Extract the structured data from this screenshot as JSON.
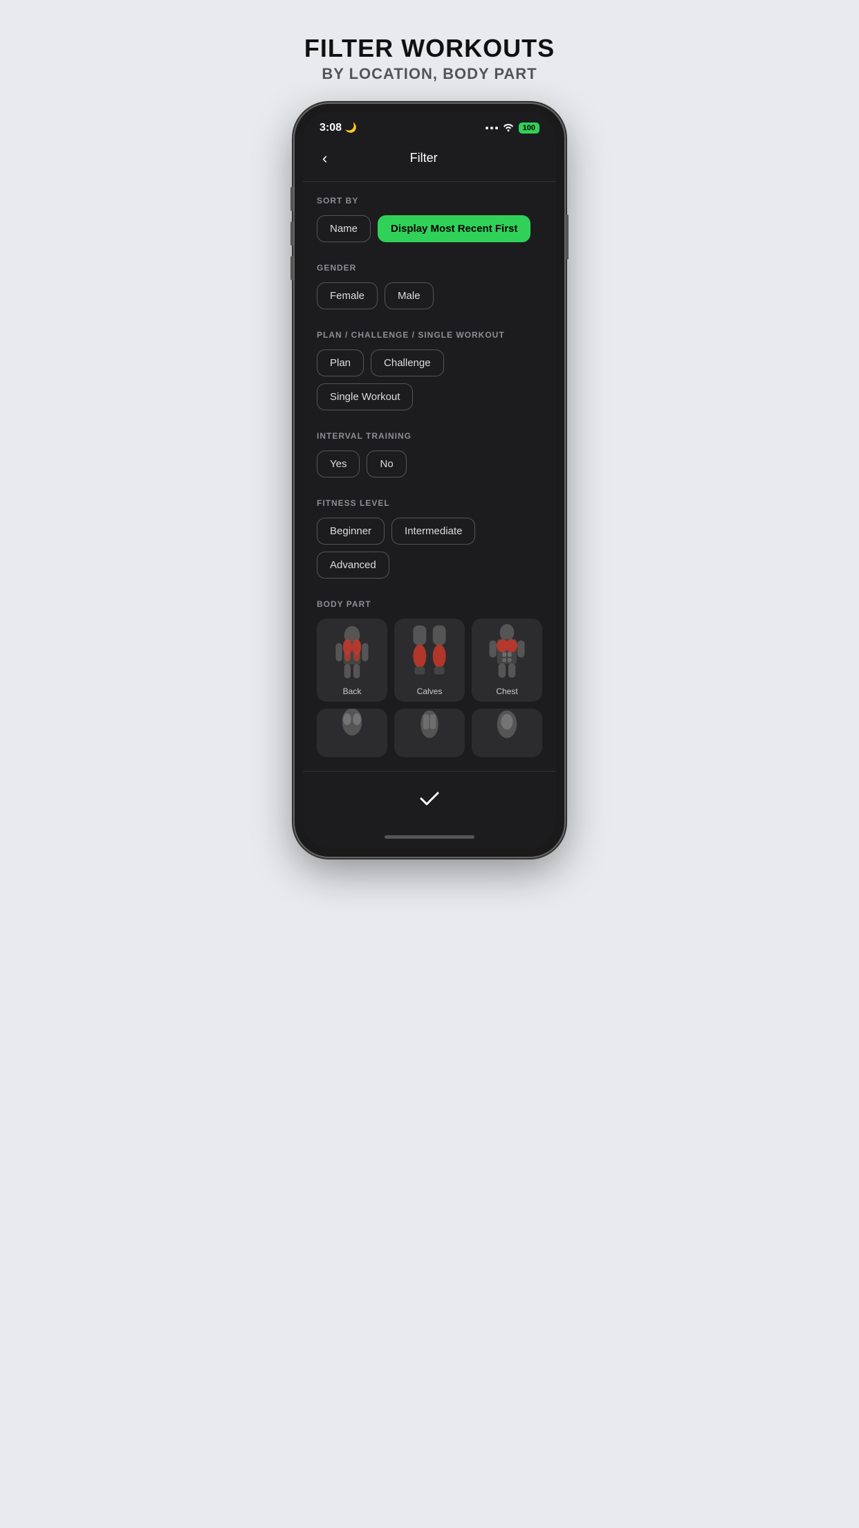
{
  "page": {
    "header": {
      "title": "FILTER WORKOUTS",
      "subtitle": "BY LOCATION, BODY PART"
    },
    "statusBar": {
      "time": "3:08",
      "moonIcon": "🌙",
      "battery": "100"
    },
    "navBar": {
      "backLabel": "‹",
      "title": "Filter"
    },
    "sections": {
      "sortBy": {
        "label": "SORT BY",
        "buttons": [
          {
            "id": "name",
            "label": "Name",
            "active": false
          },
          {
            "id": "recent",
            "label": "Display Most Recent First",
            "active": true
          }
        ]
      },
      "gender": {
        "label": "GENDER",
        "buttons": [
          {
            "id": "female",
            "label": "Female",
            "active": false
          },
          {
            "id": "male",
            "label": "Male",
            "active": false
          }
        ]
      },
      "planChallenge": {
        "label": "PLAN / CHALLENGE / SINGLE WORKOUT",
        "buttons": [
          {
            "id": "plan",
            "label": "Plan",
            "active": false
          },
          {
            "id": "challenge",
            "label": "Challenge",
            "active": false
          },
          {
            "id": "single",
            "label": "Single Workout",
            "active": false
          }
        ]
      },
      "intervalTraining": {
        "label": "INTERVAL TRAINING",
        "buttons": [
          {
            "id": "yes",
            "label": "Yes",
            "active": false
          },
          {
            "id": "no",
            "label": "No",
            "active": false
          }
        ]
      },
      "fitnessLevel": {
        "label": "FITNESS LEVEL",
        "buttons": [
          {
            "id": "beginner",
            "label": "Beginner",
            "active": false
          },
          {
            "id": "intermediate",
            "label": "Intermediate",
            "active": false
          },
          {
            "id": "advanced",
            "label": "Advanced",
            "active": false
          }
        ]
      },
      "bodyPart": {
        "label": "BODY PART",
        "items": [
          {
            "id": "back",
            "label": "Back"
          },
          {
            "id": "calves",
            "label": "Calves"
          },
          {
            "id": "chest",
            "label": "Chest"
          },
          {
            "id": "partial1",
            "label": ""
          },
          {
            "id": "partial2",
            "label": ""
          },
          {
            "id": "partial3",
            "label": ""
          }
        ]
      }
    },
    "bottomBar": {
      "confirmLabel": "✓"
    }
  }
}
